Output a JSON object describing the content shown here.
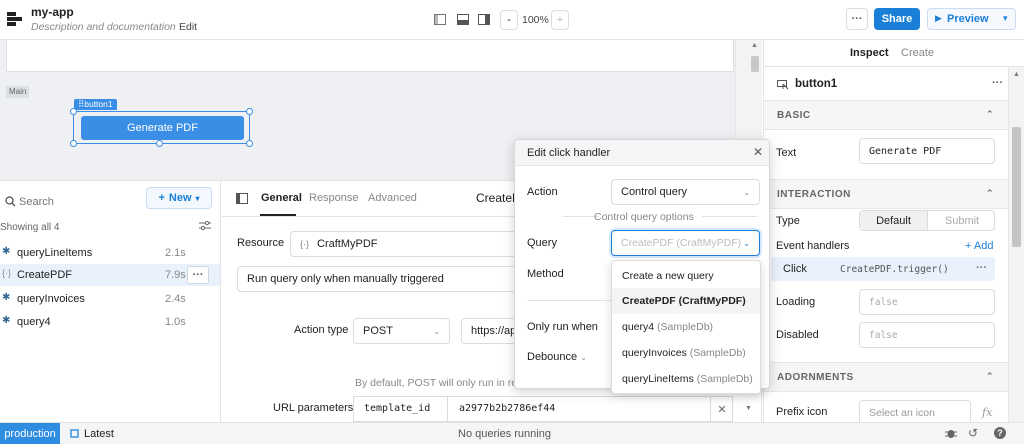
{
  "app": {
    "title": "my-app",
    "subtitle": "Description and documentation",
    "edit_label": "Edit",
    "zoom": "100%",
    "zoom_minus": "-",
    "zoom_plus": "+",
    "share_label": "Share",
    "preview_label": "Preview"
  },
  "canvas": {
    "section_label": "Main",
    "selected_component": "button1",
    "button_text": "Generate PDF"
  },
  "query_list": {
    "search_placeholder": "Search",
    "new_label": "New",
    "showing": "Showing all 4",
    "items": [
      {
        "name": "queryLineItems",
        "time": "2.1s"
      },
      {
        "name": "CreatePDF",
        "time": "7.9s"
      },
      {
        "name": "queryInvoices",
        "time": "2.4s"
      },
      {
        "name": "query4",
        "time": "1.0s"
      }
    ]
  },
  "editor": {
    "tabs": [
      "General",
      "Response",
      "Advanced"
    ],
    "query_title": "CreateP",
    "resource_label": "Resource",
    "resource_value": "CraftMyPDF",
    "trigger_mode": "Run query only when manually triggered",
    "action_type_label": "Action type",
    "action_type_value": "POST",
    "url_value": "https://api",
    "post_note": "By default, POST will only run in response to a user inter",
    "url_params_label": "URL parameters",
    "param_key": "template_id",
    "param_value": "a2977b2b2786ef44"
  },
  "inspector": {
    "tabs": [
      "Inspect",
      "Create"
    ],
    "component_name": "button1",
    "basic_header": "BASIC",
    "text_label": "Text",
    "text_value": "Generate PDF",
    "interaction_header": "INTERACTION",
    "type_label": "Type",
    "type_default": "Default",
    "type_submit": "Submit",
    "event_handlers_label": "Event handlers",
    "add_label": "+ Add",
    "handler_event": "Click",
    "handler_action": "CreatePDF.trigger()",
    "loading_label": "Loading",
    "loading_value": "false",
    "disabled_label": "Disabled",
    "disabled_value": "false",
    "adornments_header": "ADORNMENTS",
    "prefix_icon_label": "Prefix icon",
    "prefix_icon_placeholder": "Select an icon"
  },
  "popup": {
    "title": "Edit click handler",
    "action_label": "Action",
    "action_value": "Control query",
    "options_header": "Control query options",
    "query_label": "Query",
    "query_value": "CreatePDF (CraftMyPDF)",
    "method_label": "Method",
    "only_run_label": "Only run when",
    "debounce_label": "Debounce",
    "options": [
      {
        "name": "Create a new query",
        "source": ""
      },
      {
        "name": "CreatePDF",
        "source": "(CraftMyPDF)"
      },
      {
        "name": "query4",
        "source": "(SampleDb)"
      },
      {
        "name": "queryInvoices",
        "source": "(SampleDb)"
      },
      {
        "name": "queryLineItems",
        "source": "(SampleDb)"
      }
    ]
  },
  "status": {
    "env": "production",
    "version": "Latest",
    "queries": "No queries running"
  },
  "colors": {
    "primary": "#1a7fd6",
    "selection": "#3a8ee6",
    "production": "#2e8de0"
  }
}
